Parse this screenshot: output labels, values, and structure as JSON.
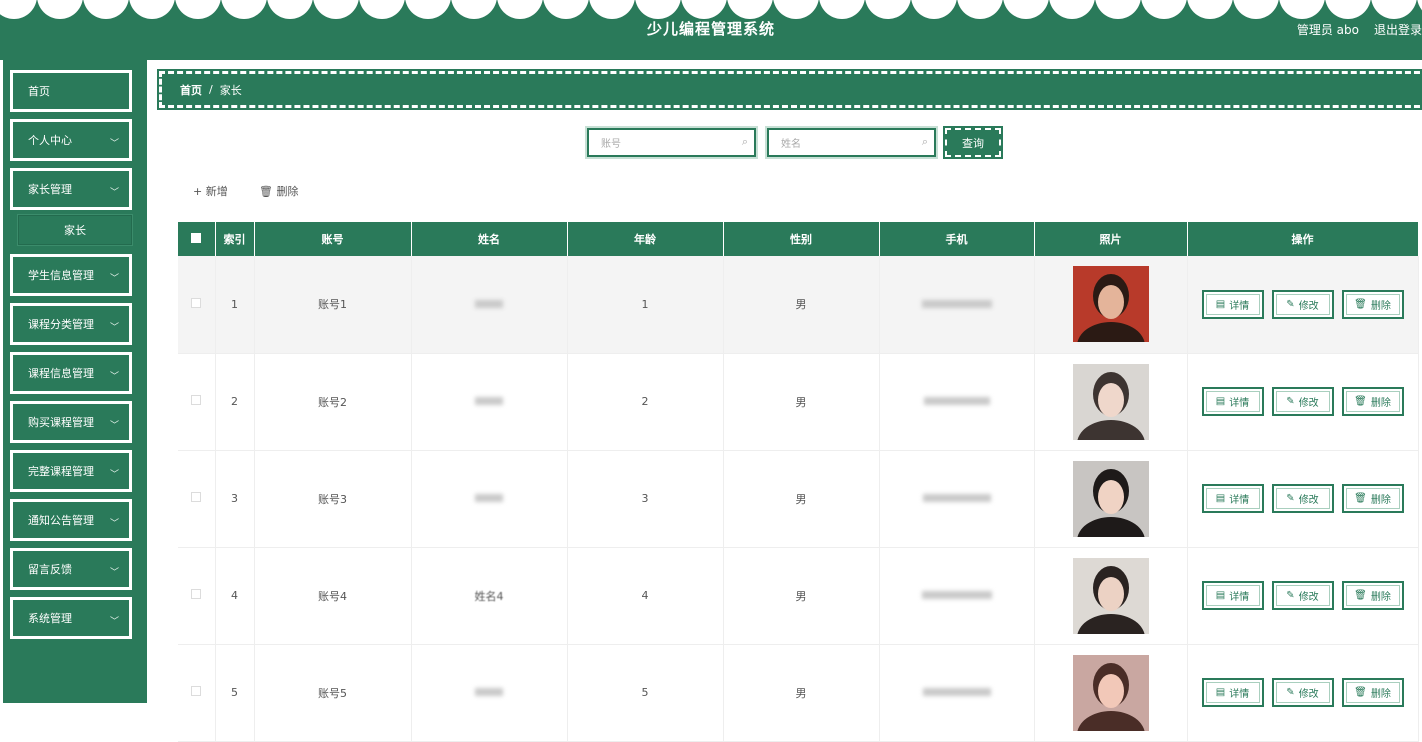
{
  "app": {
    "title": "少儿编程管理系统",
    "user_label": "管理员 abo",
    "logout_label": "退出登录"
  },
  "sidebar": {
    "items": [
      {
        "label": "首页",
        "has_chevron": false
      },
      {
        "label": "个人中心",
        "has_chevron": true
      },
      {
        "label": "家长管理",
        "has_chevron": true
      },
      {
        "label": "学生信息管理",
        "has_chevron": true
      },
      {
        "label": "课程分类管理",
        "has_chevron": true
      },
      {
        "label": "课程信息管理",
        "has_chevron": true
      },
      {
        "label": "购买课程管理",
        "has_chevron": true
      },
      {
        "label": "完整课程管理",
        "has_chevron": true
      },
      {
        "label": "通知公告管理",
        "has_chevron": true
      },
      {
        "label": "留言反馈",
        "has_chevron": true
      },
      {
        "label": "系统管理",
        "has_chevron": true
      }
    ],
    "submenu": {
      "label": "家长"
    }
  },
  "breadcrumb": {
    "home": "首页",
    "separator": "/",
    "current": "家长"
  },
  "search": {
    "account_placeholder": "账号",
    "name_placeholder": "姓名",
    "query_label": "查询"
  },
  "toolbar": {
    "add_label": "+ 新增",
    "delete_label": "删除"
  },
  "table": {
    "columns": [
      "",
      "索引",
      "账号",
      "姓名",
      "年龄",
      "性别",
      "手机",
      "照片",
      "操作"
    ],
    "rows": [
      {
        "index": "1",
        "account": "账号1",
        "name": "",
        "age": "1",
        "gender": "男"
      },
      {
        "index": "2",
        "account": "账号2",
        "name": "",
        "age": "2",
        "gender": "男"
      },
      {
        "index": "3",
        "account": "账号3",
        "name": "",
        "age": "3",
        "gender": "男"
      },
      {
        "index": "4",
        "account": "账号4",
        "name": "姓名4",
        "age": "4",
        "gender": "男"
      },
      {
        "index": "5",
        "account": "账号5",
        "name": "",
        "age": "5",
        "gender": "男"
      }
    ],
    "actions": {
      "detail": "详情",
      "edit": "修改",
      "delete": "删除"
    }
  },
  "colors": {
    "primary": "#2a7a5a",
    "highlight_row": "#f4f4f4"
  }
}
